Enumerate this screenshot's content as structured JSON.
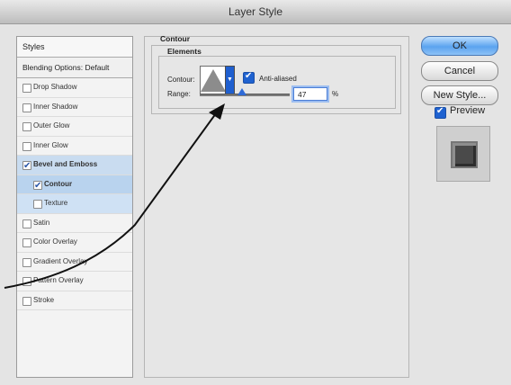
{
  "window": {
    "title": "Layer Style"
  },
  "sidebar": {
    "header": "Styles",
    "blending": "Blending Options: Default",
    "items": [
      {
        "label": "Drop Shadow",
        "checked": false
      },
      {
        "label": "Inner Shadow",
        "checked": false
      },
      {
        "label": "Outer Glow",
        "checked": false
      },
      {
        "label": "Inner Glow",
        "checked": false
      },
      {
        "label": "Bevel and Emboss",
        "checked": true
      },
      {
        "label": "Contour",
        "checked": true,
        "selected": true
      },
      {
        "label": "Texture",
        "checked": false
      },
      {
        "label": "Satin",
        "checked": false
      },
      {
        "label": "Color Overlay",
        "checked": false
      },
      {
        "label": "Gradient Overlay",
        "checked": false
      },
      {
        "label": "Pattern Overlay",
        "checked": false
      },
      {
        "label": "Stroke",
        "checked": false
      }
    ]
  },
  "panel": {
    "section_title": "Contour",
    "elements_title": "Elements",
    "contour_label": "Contour:",
    "anti_aliased_label": "Anti-aliased",
    "range_label": "Range:",
    "range_value": "47",
    "range_unit": "%",
    "range_fraction": 0.47
  },
  "buttons": {
    "ok": "OK",
    "cancel": "Cancel",
    "new_style": "New Style...",
    "preview": "Preview"
  },
  "icons": {
    "contour_dropdown": "chevron-down-icon",
    "preview_swatch": "bevel-preview-icon",
    "annotation": "arrow-icon"
  }
}
